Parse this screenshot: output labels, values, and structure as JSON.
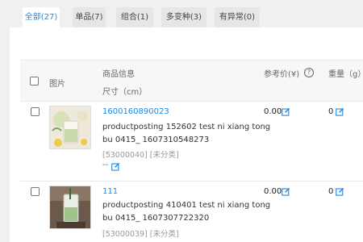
{
  "tabs": [
    {
      "label": "全部(27)",
      "active": true
    },
    {
      "label": "单品(7)",
      "active": false
    },
    {
      "label": "组合(1)",
      "active": false
    },
    {
      "label": "多变种(3)",
      "active": false
    },
    {
      "label": "有异常(0)",
      "active": false
    }
  ],
  "table": {
    "col_image": "图片",
    "col_product": "商品信息",
    "col_size": "尺寸（cm）",
    "col_price": "参考价(¥)",
    "col_weight": "重量（g）"
  },
  "rows": [
    {
      "id": "1600160890023",
      "title_line1": "productposting 152602 test ni xiang tong",
      "title_line2": "bu 0415_ 1607310548273",
      "meta": "[53000040] [未分类]",
      "size": "--",
      "price": "0.00",
      "weight": "0"
    },
    {
      "id": "111",
      "title_line1": "productposting 410401 test ni xiang tong",
      "title_line2": "bu 0415_ 1607307722320",
      "meta": "[53000039] [未分类]",
      "price": "0.00",
      "weight": "0"
    }
  ],
  "colors": {
    "accent": "#1e88e5",
    "tab_bg": "#e6e6e6",
    "header_bg": "#f7f7f7"
  },
  "icons": {
    "edit": "edit-square-icon",
    "help": "help-circle-icon"
  }
}
